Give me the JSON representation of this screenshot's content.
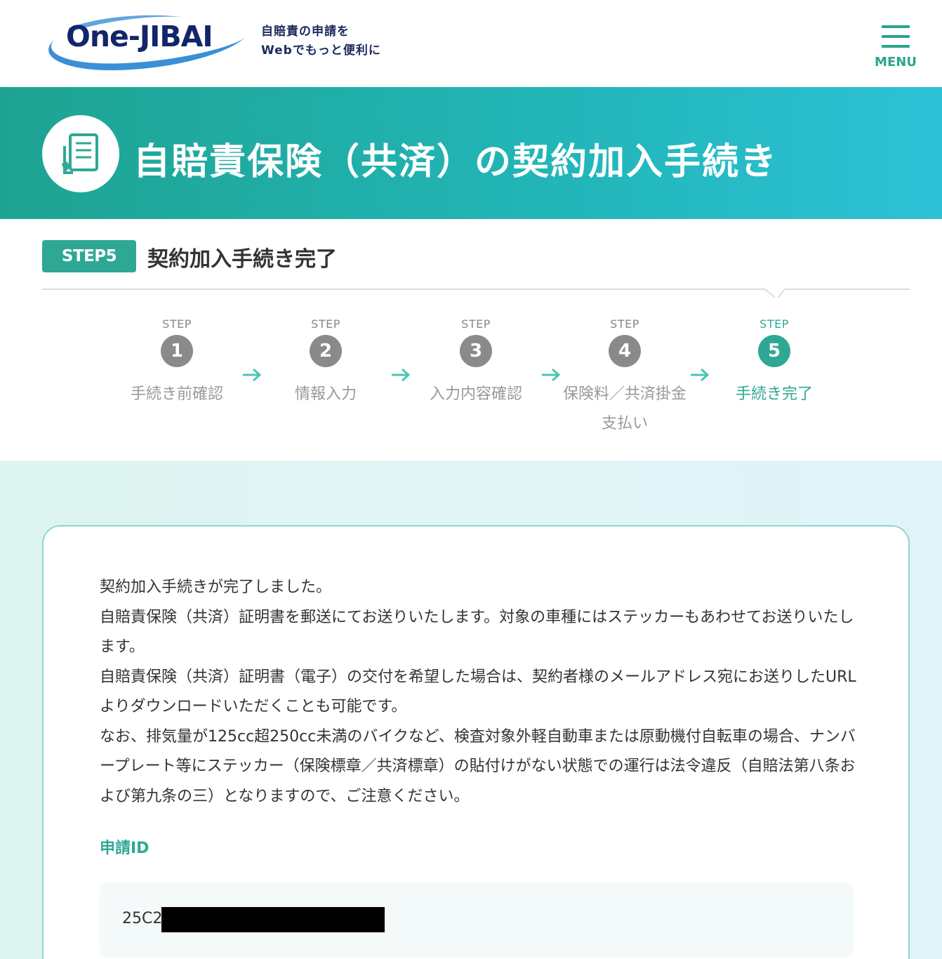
{
  "header": {
    "logo_text": "One-JIBAI",
    "tagline_line1": "自賠責の申請を",
    "tagline_line2": "Webでもっと便利に",
    "menu_label": "MENU"
  },
  "banner": {
    "title": "自賠責保険（共済）の契約加入手続き",
    "icon": "document-icon"
  },
  "step_heading": {
    "badge": "STEP5",
    "title": "契約加入手続き完了"
  },
  "stepper": {
    "steps": [
      {
        "small": "STEP",
        "number": "1",
        "label": "手続き前確認",
        "active": false
      },
      {
        "small": "STEP",
        "number": "2",
        "label": "情報入力",
        "active": false
      },
      {
        "small": "STEP",
        "number": "3",
        "label": "入力内容確認",
        "active": false
      },
      {
        "small": "STEP",
        "number": "4",
        "label": "保険料／共済掛金支払い",
        "active": false
      },
      {
        "small": "STEP",
        "number": "5",
        "label": "手続き完了",
        "active": true
      }
    ]
  },
  "card": {
    "paragraphs": [
      "契約加入手続きが完了しました。",
      "自賠責保険（共済）証明書を郵送にてお送りいたします。対象の車種にはステッカーもあわせてお送りいたします。",
      "自賠責保険（共済）証明書（電子）の交付を希望した場合は、契約者様のメールアドレス宛にお送りしたURLよりダウンロードいただくことも可能です。",
      "なお、排気量が125cc超250cc未満のバイクなど、検査対象外軽自動車または原動機付自転車の場合、ナンバープレート等にステッカー（保険標章／共済標章）の貼付けがない状態での運行は法令違反（自賠法第八条および第九条の三）となりますので、ご注意ください。"
    ],
    "id_label": "申請ID",
    "id_value": "25C2"
  },
  "colors": {
    "accent": "#2ea895",
    "logo_navy": "#12256b",
    "banner_start": "#1ea391",
    "banner_end": "#2cc1d6"
  }
}
